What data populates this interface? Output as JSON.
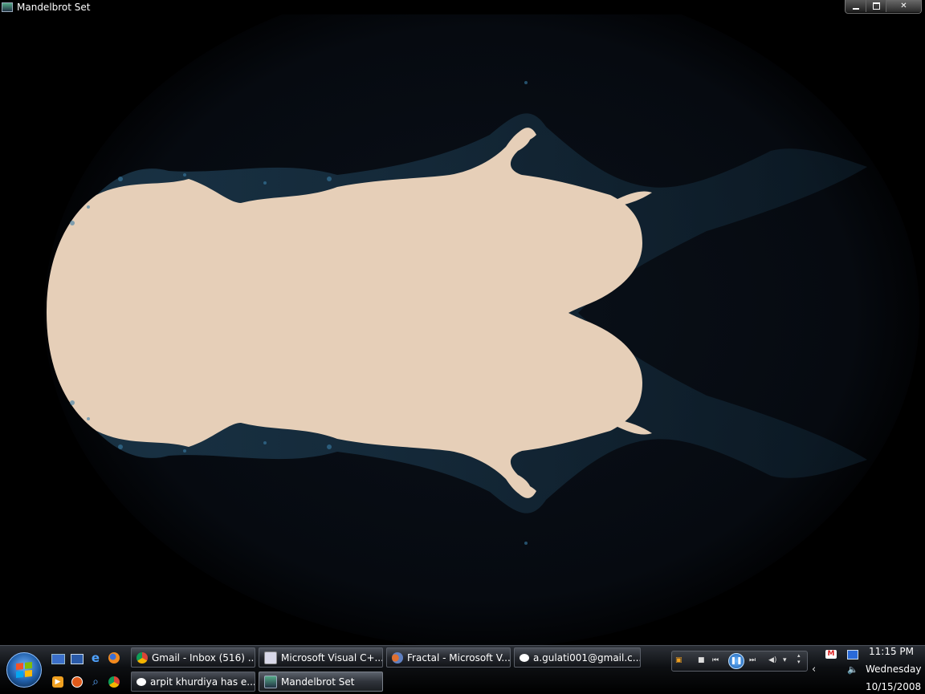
{
  "window": {
    "title": "Mandelbrot Set",
    "controls": {
      "minimize": "minimize",
      "maximize": "maximize",
      "close": "close"
    }
  },
  "canvas": {
    "set_color": "#e6cfb8",
    "background_color": "#000000",
    "filament_color": "#173247",
    "disc_color": "#04070b"
  },
  "taskbar": {
    "quick_launch_row1": [
      "show-desktop-icon",
      "switch-windows-icon",
      "internet-explorer-icon",
      "firefox-icon"
    ],
    "quick_launch_row2": [
      "media-player-icon",
      "ubuntu-icon",
      "search-icon",
      "chrome-icon"
    ],
    "row1": [
      {
        "label": "Gmail - Inbox (516) ...",
        "icon": "chrome-icon"
      },
      {
        "label": "Microsoft Visual C+...",
        "icon": "visual-studio-icon"
      },
      {
        "label": "Fractal - Microsoft V...",
        "icon": "fractal-icon"
      },
      {
        "label": "a.gulati001@gmail.c...",
        "icon": "chat-icon"
      }
    ],
    "row2": [
      {
        "label": "arpit khurdiya has e...",
        "icon": "chat-icon"
      },
      {
        "label": "Mandelbrot Set",
        "icon": "mandelbrot-app-icon"
      }
    ]
  },
  "tray": {
    "time": "11:15 PM",
    "day": "Wednesday",
    "date": "10/15/2008",
    "icons": [
      "gmail-notifier-icon",
      "network-icon",
      "volume-icon",
      "show-hidden-icons-chevron"
    ]
  }
}
